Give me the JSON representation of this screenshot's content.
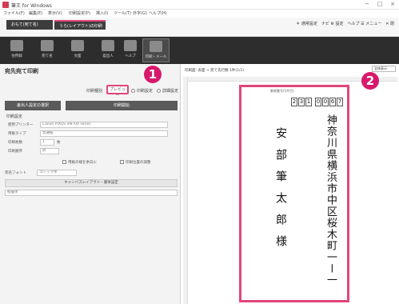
{
  "window": {
    "title": "筆王 for Windows",
    "controls": [
      "−",
      "□",
      "×"
    ]
  },
  "menu": [
    "ファイル(F)",
    "編集(E)",
    "表示(V)",
    "印刷設定(P)",
    "挿入(I)",
    "ツール(T)",
    "外字(G)",
    "ヘルプ(H)"
  ],
  "tabs": {
    "tab1": "おもて(宛て名)",
    "tab2": "うら(レイアウト)の印刷"
  },
  "toplinks": "＊ 通常設定　ナビ ⚙ 設定　ヘルプ ☰ メニュー　✕ 閉",
  "ribbon": [
    {
      "label": "住所録",
      "icon": "address-book-icon"
    },
    {
      "label": "宛て名",
      "icon": "address-icon"
    },
    {
      "label": "文面",
      "icon": "design-icon"
    },
    {
      "label": "差出人",
      "icon": "sender-icon"
    },
    {
      "label": "ヘルプ",
      "icon": "help-icon"
    },
    {
      "label": "印刷・メール",
      "icon": "print-icon"
    }
  ],
  "panel": {
    "title": "宛先宛て印刷",
    "radio_label1": "印刷種別",
    "preview_label": "プレビュー",
    "radio_label2": "印刷設定",
    "radio_label3": "詳細設定",
    "btn_left": "差出人設定の選択",
    "btn_right": "印刷開始",
    "section_settings": "印刷設定",
    "printer_label": "使用プリンター",
    "printer_value": "Canon PIXUS iP8700 series",
    "paper_label": "用紙タイプ",
    "paper_value": "普通紙",
    "copies_label": "印刷枚数",
    "copies_value": "1",
    "copies_unit": "枚",
    "order_label": "印刷順序",
    "order_value": "昇",
    "check1": "用紙の端を余白に",
    "check2": "印刷位置の調整",
    "font_label": "宛名フォント",
    "font_value": "ゴシック体",
    "layout_btn": "キャンバスレイアウト・書体設定",
    "bottom_value": "楷書体"
  },
  "badges": {
    "one": "1",
    "two": "2"
  },
  "preview": {
    "info": "印刷面: 表面 → 宛て先行数  1件(1/1)",
    "zoom": "全体表示",
    "zip_caption": "郵便番号(1件目)",
    "zip": [
      "2",
      "3",
      "1",
      "0",
      "0",
      "6",
      "7"
    ],
    "address": "神奈川県横浜市中区桜木町一ー一",
    "recipient": "安部筆太郎様"
  }
}
